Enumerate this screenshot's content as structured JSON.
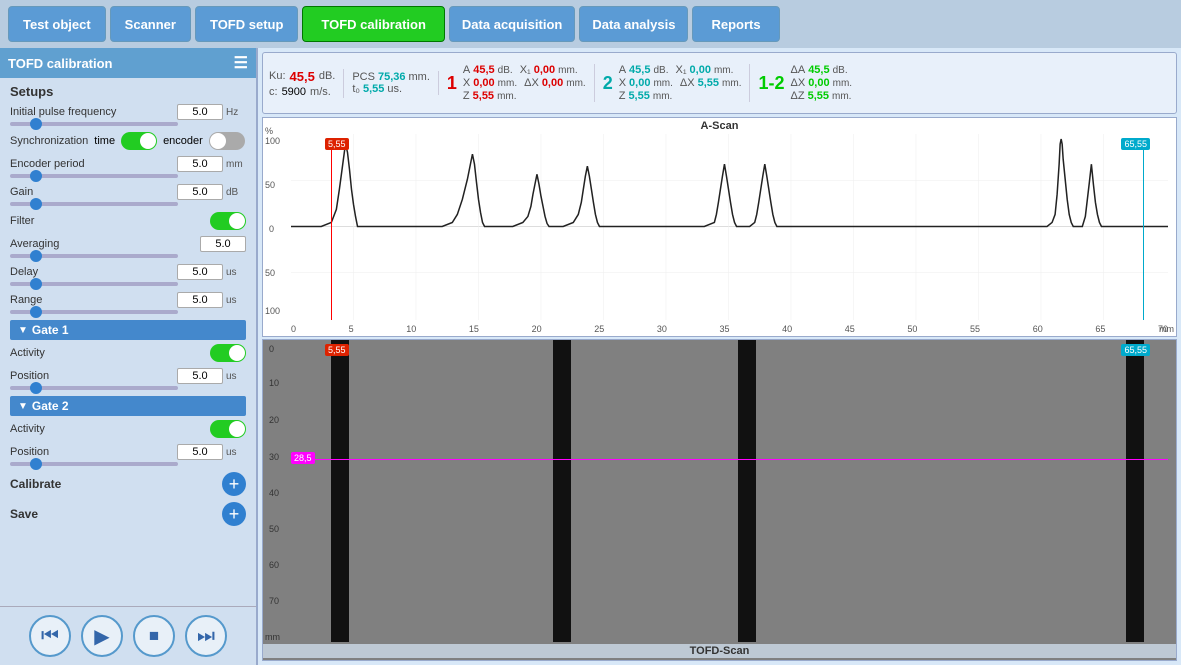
{
  "nav": {
    "items": [
      {
        "label": "Test object",
        "id": "test-object",
        "active": false
      },
      {
        "label": "Scanner",
        "id": "scanner",
        "active": false
      },
      {
        "label": "TOFD setup",
        "id": "tofd-setup",
        "active": false
      },
      {
        "label": "TOFD calibration",
        "id": "tofd-calibration",
        "active": true
      },
      {
        "label": "Data acquisition",
        "id": "data-acquisition",
        "active": false
      },
      {
        "label": "Data analysis",
        "id": "data-analysis",
        "active": false
      },
      {
        "label": "Reports",
        "id": "reports",
        "active": false
      }
    ]
  },
  "panel": {
    "title": "TOFD calibration",
    "setups_label": "Setups",
    "initial_pulse_freq_label": "Initial pulse frequency",
    "initial_pulse_freq_val": "5.0",
    "initial_pulse_freq_unit": "Hz",
    "sync_label": "Synchronization",
    "sync_time": "time",
    "sync_encoder": "encoder",
    "encoder_period_label": "Encoder period",
    "encoder_period_val": "5.0",
    "encoder_period_unit": "mm",
    "gain_label": "Gain",
    "gain_val": "5.0",
    "gain_unit": "dB",
    "filter_label": "Filter",
    "averaging_label": "Averaging",
    "averaging_val": "5.0",
    "delay_label": "Delay",
    "delay_val": "5.0",
    "delay_unit": "us",
    "range_label": "Range",
    "range_val": "5.0",
    "range_unit": "us",
    "gate1_label": "Gate  1",
    "gate1_activity_label": "Activity",
    "gate1_position_label": "Position",
    "gate1_position_val": "5.0",
    "gate1_position_unit": "us",
    "gate2_label": "Gate 2",
    "gate2_activity_label": "Activity",
    "gate2_position_label": "Position",
    "gate2_position_val": "5.0",
    "gate2_position_unit": "us",
    "calibrate_label": "Calibrate",
    "save_label": "Save"
  },
  "measurements": {
    "ku_label": "Ku:",
    "ku_val": "45,5",
    "ku_unit": "dB.",
    "pcs_label": "PCS",
    "pcs_val": "75,36",
    "pcs_unit": "mm.",
    "t0_label": "t₀",
    "t0_val": "5,55",
    "t0_unit": "us.",
    "marker1": {
      "num": "1",
      "A_label": "A",
      "A_val": "45,5",
      "A_unit": "dB.",
      "X1_label": "X₁",
      "X1_val": "0,00",
      "X1_unit": "mm.",
      "X_label": "X",
      "X_val": "0,00",
      "X_unit": "mm.",
      "Z_label": "Z",
      "Z_val": "5,55",
      "Z_unit": "mm.",
      "dX_label": "ΔX",
      "dX_val": "0,00",
      "dX_unit": "mm."
    },
    "marker2": {
      "num": "2",
      "A_label": "A",
      "A_val": "45,5",
      "A_unit": "dB.",
      "X1_label": "X₁",
      "X1_val": "0,00",
      "X1_unit": "mm.",
      "X_label": "X",
      "X_val": "0,00",
      "X_unit": "mm.",
      "Z_label": "Z",
      "Z_val": "5,55",
      "Z_unit": "mm.",
      "dX_label": "ΔX",
      "dX_val": "5,55",
      "dX_unit": "mm."
    },
    "marker12": {
      "num": "1-2",
      "dA_label": "ΔA",
      "dA_val": "45,5",
      "dA_unit": "dB.",
      "dX_label": "ΔX",
      "dX_val": "0,00",
      "dX_unit": "mm.",
      "dZ_label": "ΔZ",
      "dZ_val": "5,55",
      "dZ_unit": "mm."
    }
  },
  "ascan": {
    "title": "A-Scan",
    "y_labels": [
      "100",
      "50",
      "0",
      "50",
      "100"
    ],
    "x_labels": [
      "0",
      "5",
      "10",
      "15",
      "20",
      "25",
      "30",
      "35",
      "40",
      "45",
      "50",
      "55",
      "60",
      "65",
      "70"
    ],
    "x_unit": "mm",
    "y_unit": "%",
    "marker_left_val": "5,55",
    "marker_right_val": "65,55"
  },
  "tofd": {
    "title": "TOFD-Scan",
    "y_labels": [
      "0",
      "10",
      "20",
      "30",
      "40",
      "50",
      "60",
      "70"
    ],
    "y_unit": "mm",
    "marker_left_val": "5,55",
    "marker_right_val": "65,55",
    "gate_label": "28,5",
    "vertical_positions": [
      7.5,
      24,
      38,
      52,
      88
    ]
  },
  "transport": {
    "rewind": "⏮",
    "play": "▶",
    "stop": "⏹",
    "forward": "⏭"
  }
}
